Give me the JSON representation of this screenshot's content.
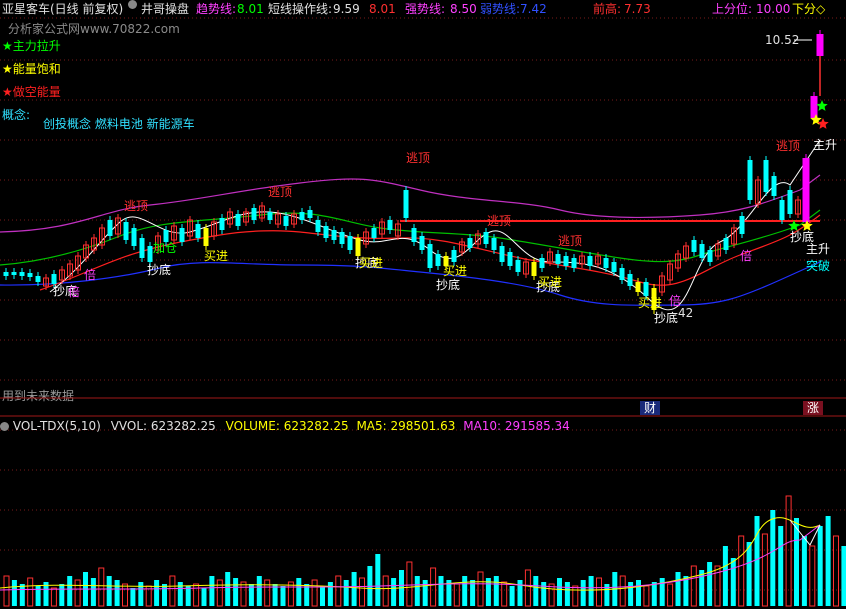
{
  "header": {
    "stock_title": "亚星客车(日线 前复权)",
    "indicator_name": "井哥操盘",
    "trend_label": "趋势线:",
    "trend_value": "8.01",
    "short_label": "短线操作线:",
    "short_value": "9.59",
    "short_extra": "8.01",
    "strong_label": "强势线:",
    "strong_value": "8.50",
    "weak_label": "弱势线:",
    "weak_value": "7.42",
    "high_label": "前高:",
    "high_value": "7.73",
    "upper_label": "上分位:",
    "upper_value": "10.00",
    "trailing": "下分◇"
  },
  "watermark": "分析家公式网www.70822.com",
  "legend": [
    {
      "label": "主力拉升",
      "color": "#00ff00"
    },
    {
      "label": "能量饱和",
      "color": "#ffff00"
    },
    {
      "label": "做空能量",
      "color": "#ff2020"
    }
  ],
  "concept": {
    "label": "概念:",
    "value": "创投概念 燃料电池 新能源车"
  },
  "price_max_label": "10.52",
  "price_min_label": "42",
  "future_note": "用到未来数据",
  "markers": {
    "cai": "财",
    "zhang": "涨"
  },
  "signals": {
    "escape": "逃顶",
    "bottom": "抄底",
    "buy": "买进",
    "add": "加仓",
    "double": "倍",
    "main_rise": "主升",
    "breakthrough": "突破"
  },
  "volume_header": {
    "name": "VOL-TDX(5,10)",
    "vvol": "VVOL: 623282.25",
    "volume": "VOLUME: 623282.25",
    "ma5": "MA5: 298501.63",
    "ma10": "MA10: 291585.34"
  },
  "colors": {
    "up": "#ff3030",
    "down": "#00ffff",
    "buy": "#ffff00",
    "upper_band": "#c030c0",
    "lower_band": "#2030ff",
    "mid": "#00c000",
    "trend": "#ff2020",
    "hot": "#ff00ff"
  }
}
